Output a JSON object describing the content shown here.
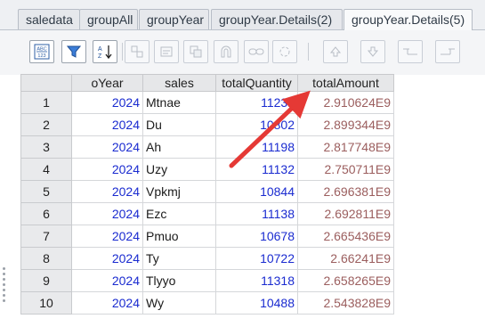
{
  "tabs": [
    {
      "label": "saledata",
      "active": false
    },
    {
      "label": "groupAll",
      "active": false
    },
    {
      "label": "groupYear",
      "active": false
    },
    {
      "label": "groupYear.Details(2)",
      "active": false
    },
    {
      "label": "groupYear.Details(5)",
      "active": true
    }
  ],
  "toolbar": {
    "buttons": [
      {
        "icon": "abc-123-icon",
        "enabled": true
      },
      {
        "icon": "filter-icon",
        "enabled": true
      },
      {
        "icon": "sort-az-icon",
        "enabled": true
      },
      {
        "icon": "link-icon",
        "enabled": false
      },
      {
        "icon": "edit-icon",
        "enabled": false
      },
      {
        "icon": "copy-icon",
        "enabled": false
      },
      {
        "icon": "magnet-icon",
        "enabled": false
      },
      {
        "icon": "chain-icon",
        "enabled": false
      },
      {
        "icon": "refresh-icon",
        "enabled": false
      },
      {
        "icon": "arrow-up-icon",
        "enabled": false
      },
      {
        "icon": "arrow-down-icon",
        "enabled": false
      },
      {
        "icon": "indent-icon",
        "enabled": false
      },
      {
        "icon": "outdent-icon",
        "enabled": false
      }
    ]
  },
  "grid": {
    "columns": [
      "",
      "oYear",
      "sales",
      "totalQuantity",
      "totalAmount"
    ],
    "rows": [
      {
        "n": "1",
        "oYear": "2024",
        "sales": "Mtnae",
        "totalQuantity": "11231",
        "totalAmount": "2.910624E9"
      },
      {
        "n": "2",
        "oYear": "2024",
        "sales": "Du",
        "totalQuantity": "10802",
        "totalAmount": "2.899344E9"
      },
      {
        "n": "3",
        "oYear": "2024",
        "sales": "Ah",
        "totalQuantity": "11198",
        "totalAmount": "2.817748E9"
      },
      {
        "n": "4",
        "oYear": "2024",
        "sales": "Uzy",
        "totalQuantity": "11132",
        "totalAmount": "2.750711E9"
      },
      {
        "n": "5",
        "oYear": "2024",
        "sales": "Vpkmj",
        "totalQuantity": "10844",
        "totalAmount": "2.696381E9"
      },
      {
        "n": "6",
        "oYear": "2024",
        "sales": "Ezc",
        "totalQuantity": "11138",
        "totalAmount": "2.692811E9"
      },
      {
        "n": "7",
        "oYear": "2024",
        "sales": "Pmuo",
        "totalQuantity": "10678",
        "totalAmount": "2.665436E9"
      },
      {
        "n": "8",
        "oYear": "2024",
        "sales": "Ty",
        "totalQuantity": "10722",
        "totalAmount": "2.66241E9"
      },
      {
        "n": "9",
        "oYear": "2024",
        "sales": "Tlyyo",
        "totalQuantity": "11318",
        "totalAmount": "2.658265E9"
      },
      {
        "n": "10",
        "oYear": "2024",
        "sales": "Wy",
        "totalQuantity": "10488",
        "totalAmount": "2.543828E9"
      }
    ]
  },
  "annotation": {
    "color": "#e53935"
  }
}
